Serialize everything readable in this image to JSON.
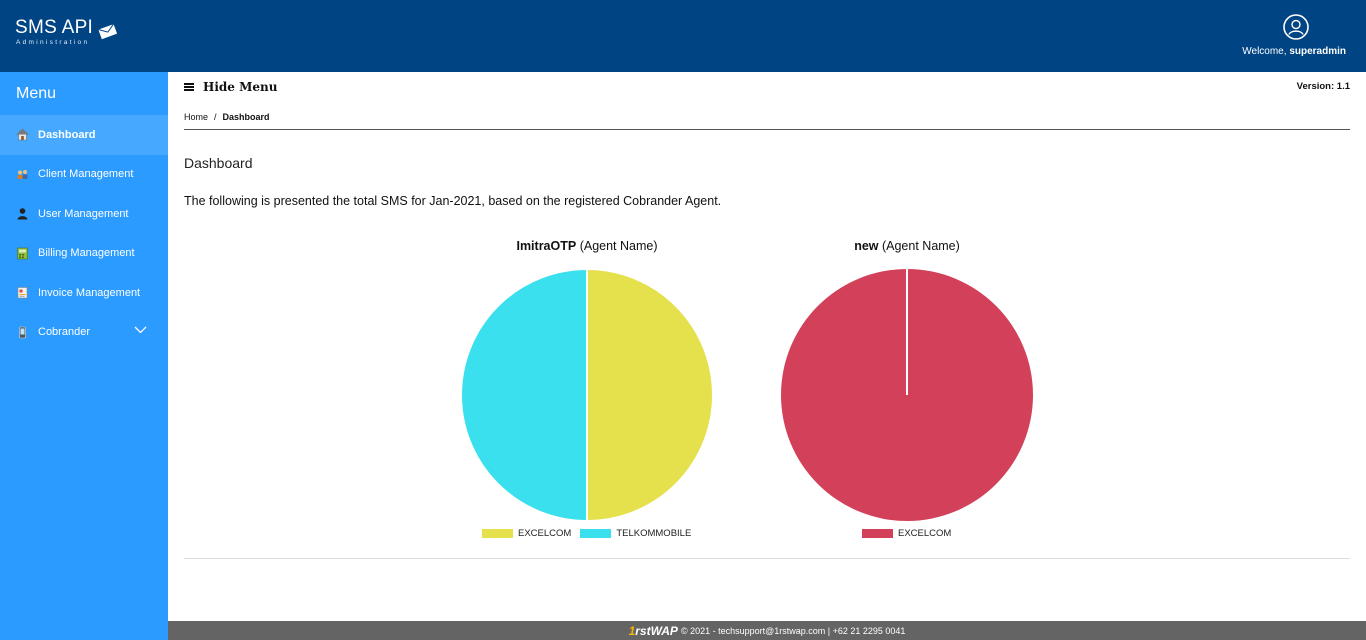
{
  "header": {
    "logo_title": "SMS API",
    "logo_subtitle": "Administration",
    "welcome_prefix": "Welcome,",
    "username": "superadmin"
  },
  "sidebar": {
    "title": "Menu",
    "items": [
      {
        "label": "Dashboard",
        "icon": "home-icon",
        "active": true
      },
      {
        "label": "Client Management",
        "icon": "clients-icon",
        "active": false
      },
      {
        "label": "User Management",
        "icon": "user-icon",
        "active": false
      },
      {
        "label": "Billing Management",
        "icon": "billing-icon",
        "active": false
      },
      {
        "label": "Invoice Management",
        "icon": "invoice-icon",
        "active": false
      },
      {
        "label": "Cobrander",
        "icon": "phone-icon",
        "active": false
      }
    ]
  },
  "main": {
    "hide_menu_label": "Hide Menu",
    "version": "Version: 1.1",
    "breadcrumb": {
      "home": "Home",
      "separator": "/",
      "current": "Dashboard"
    },
    "page_title": "Dashboard",
    "description": "The following is presented the total SMS for Jan-2021, based on the registered Cobrander Agent."
  },
  "chart_data": [
    {
      "type": "pie",
      "title_agent": "ImitraOTP",
      "title_suffix": "(Agent Name)",
      "slices": [
        {
          "label": "EXCELCOM",
          "value": 50,
          "color": "#e5e14d"
        },
        {
          "label": "TELKOMMOBILE",
          "value": 50,
          "color": "#3be0ee"
        }
      ],
      "legend": "bottom"
    },
    {
      "type": "pie",
      "title_agent": "new",
      "title_suffix": "(Agent Name)",
      "slices": [
        {
          "label": "EXCELCOM",
          "value": 100,
          "color": "#d2405a"
        }
      ],
      "legend": "bottom"
    }
  ],
  "footer": {
    "brand_one": "1",
    "brand_rest": "rstWAP",
    "text": "© 2021 - techsupport@1rstwap.com | +62 21 2295 0041"
  },
  "colors": {
    "header_bg": "#004483",
    "sidebar_bg": "#2b9bff",
    "sidebar_active_bg": "#46a9ff",
    "footer_bg": "#646464"
  }
}
